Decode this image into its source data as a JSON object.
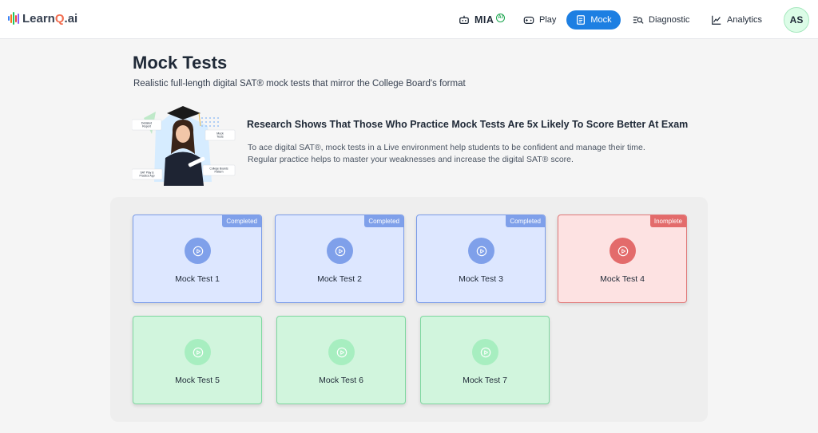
{
  "app": {
    "logo_prefix": "Learn",
    "logo_q": "Q",
    "logo_suffix": ".ai"
  },
  "nav": {
    "mia_label": "MIA",
    "mia_badge": "AI",
    "play_label": "Play",
    "mock_label": "Mock",
    "diagnostic_label": "Diagnostic",
    "analytics_label": "Analytics",
    "avatar_initials": "AS"
  },
  "header": {
    "title": "Mock Tests",
    "subtitle": "Realistic full-length digital SAT® mock tests that mirror the College Board's format"
  },
  "hero": {
    "labels": {
      "detailed_report": "Detailed Report",
      "mock_tests": "Mock Tests",
      "sat_play": "SAT Play & Practice App",
      "college_board": "College Boards Pattern"
    },
    "title": "Research Shows That Those Who Practice Mock Tests Are 5x Likely To Score Better At Exam",
    "desc_line1": "To ace digital SAT®, mock tests in a Live environment help students to be confident and manage their time.",
    "desc_line2": "Regular practice helps to master your weaknesses and increase the digital SAT® score."
  },
  "tests": [
    {
      "label": "Mock Test 1",
      "status": "Completed"
    },
    {
      "label": "Mock Test 2",
      "status": "Completed"
    },
    {
      "label": "Mock Test 3",
      "status": "Completed"
    },
    {
      "label": "Mock Test 4",
      "status": "Inomplete"
    },
    {
      "label": "Mock Test 5",
      "status": ""
    },
    {
      "label": "Mock Test 6",
      "status": ""
    },
    {
      "label": "Mock Test 7",
      "status": ""
    }
  ],
  "colors": {
    "accent": "#1d7fe2",
    "completed": "#7fa0ea",
    "incomplete": "#e36b6b",
    "not_started": "#a7eec0"
  }
}
